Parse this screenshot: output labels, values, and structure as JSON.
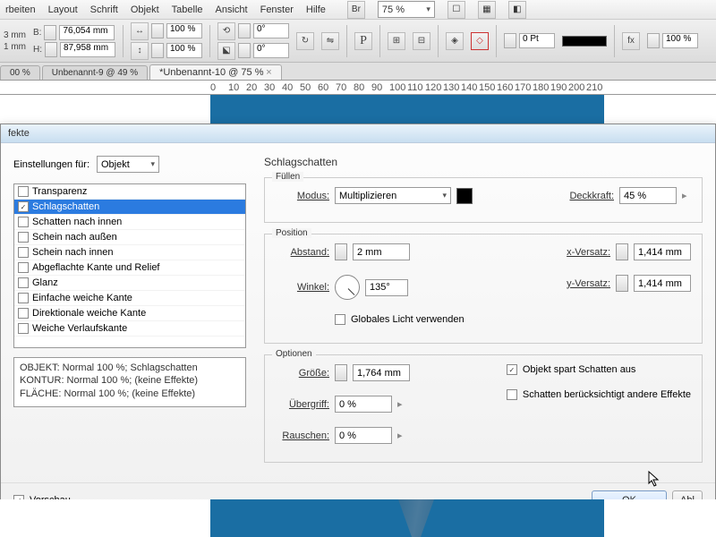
{
  "menu": [
    "rbeiten",
    "Layout",
    "Schrift",
    "Objekt",
    "Tabelle",
    "Ansicht",
    "Fenster",
    "Hilfe"
  ],
  "zoom_display": "75 %",
  "toolbar": {
    "x": "3 mm",
    "b": "76,054 mm",
    "y": "1 mm",
    "h": "87,958 mm",
    "scale_x": "100 %",
    "scale_y": "100 %",
    "rotate": "0°",
    "shear": "0°",
    "stroke": "0 Pt",
    "opacity": "100 %"
  },
  "tabs": [
    {
      "label": "00 %"
    },
    {
      "label": "Unbenannt-9 @ 49 %"
    },
    {
      "label": "*Unbenannt-10 @ 75 %",
      "active": true
    }
  ],
  "ruler_ticks": [
    "0",
    "10",
    "20",
    "30",
    "40",
    "50",
    "60",
    "70",
    "80",
    "90",
    "100",
    "110",
    "120",
    "130",
    "140",
    "150",
    "160",
    "170",
    "180",
    "190",
    "200",
    "210"
  ],
  "dialog": {
    "title": "fekte",
    "settings_for_label": "Einstellungen für:",
    "settings_for_value": "Objekt",
    "effects": [
      {
        "label": "Transparenz",
        "checked": false
      },
      {
        "label": "Schlagschatten",
        "checked": true,
        "selected": true
      },
      {
        "label": "Schatten nach innen",
        "checked": false
      },
      {
        "label": "Schein nach außen",
        "checked": false
      },
      {
        "label": "Schein nach innen",
        "checked": false
      },
      {
        "label": "Abgeflachte Kante und Relief",
        "checked": false
      },
      {
        "label": "Glanz",
        "checked": false
      },
      {
        "label": "Einfache weiche Kante",
        "checked": false
      },
      {
        "label": "Direktionale weiche Kante",
        "checked": false
      },
      {
        "label": "Weiche Verlaufskante",
        "checked": false
      }
    ],
    "summary": [
      "OBJEKT: Normal 100 %; Schlagschatten",
      "KONTUR: Normal 100 %; (keine Effekte)",
      "FLÄCHE: Normal 100 %; (keine Effekte)"
    ],
    "section_title": "Schlagschatten",
    "fill": {
      "legend": "Füllen",
      "mode_label": "Modus:",
      "mode_value": "Multiplizieren",
      "opacity_label": "Deckkraft:",
      "opacity_value": "45 %"
    },
    "position": {
      "legend": "Position",
      "distance_label": "Abstand:",
      "distance_value": "2 mm",
      "angle_label": "Winkel:",
      "angle_value": "135°",
      "global_light": "Globales Licht verwenden",
      "x_offset_label": "x-Versatz:",
      "x_offset_value": "1,414 mm",
      "y_offset_label": "y-Versatz:",
      "y_offset_value": "1,414 mm"
    },
    "options": {
      "legend": "Optionen",
      "size_label": "Größe:",
      "size_value": "1,764 mm",
      "spread_label": "Übergriff:",
      "spread_value": "0 %",
      "noise_label": "Rauschen:",
      "noise_value": "0 %",
      "knockout": "Objekt spart Schatten aus",
      "other_effects": "Schatten berücksichtigt andere Effekte"
    },
    "preview": "Vorschau",
    "ok": "OK",
    "cancel": "Abl"
  }
}
